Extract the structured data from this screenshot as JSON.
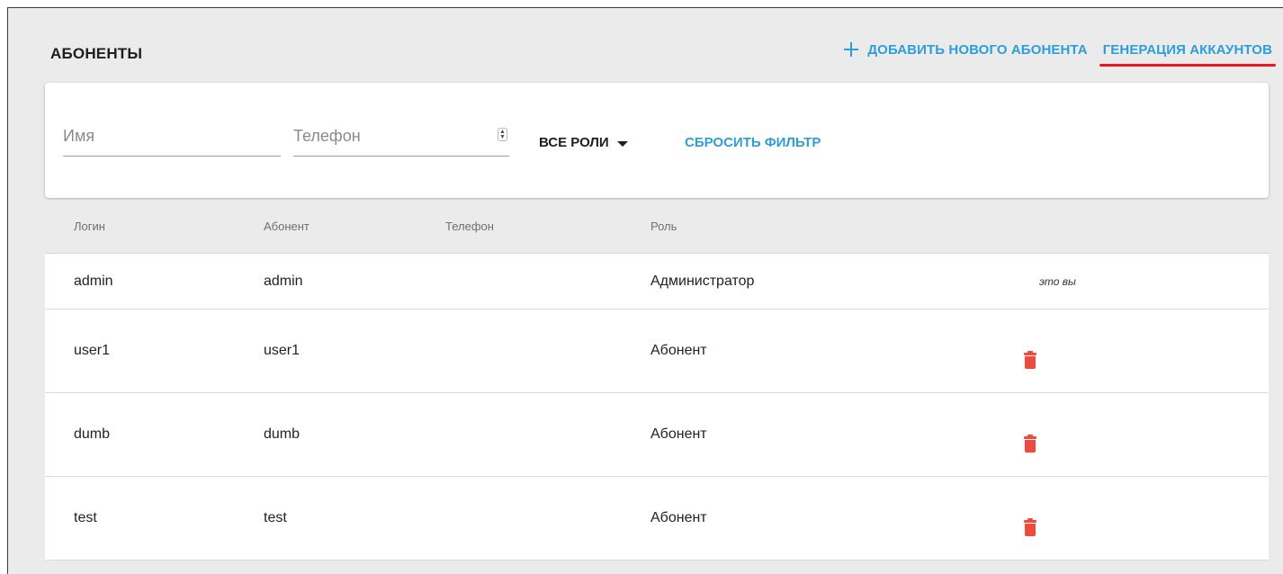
{
  "page": {
    "title": "АБОНЕНТЫ",
    "add_link": "ДОБАВИТЬ НОВОГО АБОНЕНТА",
    "generate_link": "ГЕНЕРАЦИЯ АККАУНТОВ",
    "accent_color": "#2d9ed8",
    "highlight_color": "#e8171d"
  },
  "filters": {
    "name_placeholder": "Имя",
    "phone_placeholder": "Телефон",
    "roles_label": "ВСЕ РОЛИ",
    "reset_label": "СБРОСИТЬ ФИЛЬТР"
  },
  "table": {
    "columns": [
      "Логин",
      "Абонент",
      "Телефон",
      "Роль"
    ],
    "rows": [
      {
        "login": "admin",
        "name": "admin",
        "phone": "",
        "role": "Администратор",
        "note": "это вы",
        "deletable": false
      },
      {
        "login": "user1",
        "name": "user1",
        "phone": "",
        "role": "Абонент",
        "note": "",
        "deletable": true
      },
      {
        "login": "dumb",
        "name": "dumb",
        "phone": "",
        "role": "Абонент",
        "note": "",
        "deletable": true
      },
      {
        "login": "test",
        "name": "test",
        "phone": "",
        "role": "Абонент",
        "note": "",
        "deletable": true
      }
    ],
    "delete_color": "#ef4b3c"
  }
}
